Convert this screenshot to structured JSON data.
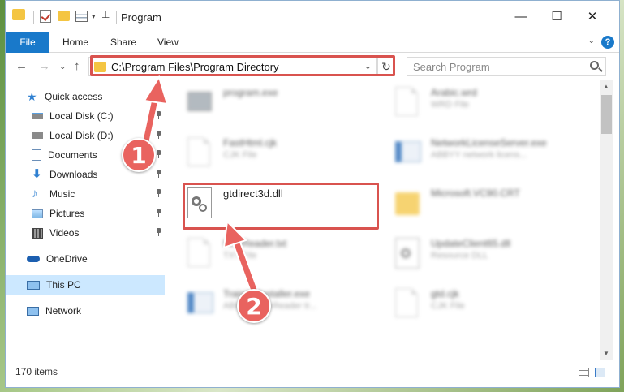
{
  "window": {
    "title": "Program",
    "minimize_glyph": "—",
    "maximize_glyph": "☐",
    "close_glyph": "✕"
  },
  "ribbon": {
    "file": "File",
    "tabs": [
      "Home",
      "Share",
      "View"
    ],
    "help": "?"
  },
  "address": {
    "path": "C:\\Program Files\\Program Directory",
    "search_placeholder": "Search Program"
  },
  "nav_pane": {
    "items": [
      {
        "label": "Quick access",
        "icon": "star-icon"
      },
      {
        "label": "Local Disk (C:)",
        "icon": "drive-icon",
        "pinned": true
      },
      {
        "label": "Local Disk (D:)",
        "icon": "drive-icon",
        "pinned": true
      },
      {
        "label": "Documents",
        "icon": "documents-icon",
        "pinned": true
      },
      {
        "label": "Downloads",
        "icon": "download-icon",
        "pinned": true
      },
      {
        "label": "Music",
        "icon": "music-icon",
        "pinned": true
      },
      {
        "label": "Pictures",
        "icon": "pictures-icon",
        "pinned": true
      },
      {
        "label": "Videos",
        "icon": "videos-icon",
        "pinned": true
      },
      {
        "label": "OneDrive",
        "icon": "cloud-icon"
      },
      {
        "label": "This PC",
        "icon": "computer-icon",
        "selected": true
      },
      {
        "label": "Network",
        "icon": "network-icon"
      }
    ]
  },
  "files": [
    {
      "name": "program.exe",
      "type": ""
    },
    {
      "name": "Arabic.wrd",
      "type": "WRD File"
    },
    {
      "name": "FastHtml.cjk",
      "type": "CJK File"
    },
    {
      "name": "NetworkLicenseServer.exe",
      "type": "ABBYY network licens..."
    },
    {
      "name": "gtdirect3d.dll",
      "type": ""
    },
    {
      "name": "Microsoft.VC90.CRT",
      "type": ""
    },
    {
      "name": "FineReader.txt",
      "type": "TXT File"
    },
    {
      "name": "UpdateClient65.dll",
      "type": "Resource DLL"
    },
    {
      "name": "TrainingInstaller.exe",
      "type": "ABBYY FineReader tr..."
    },
    {
      "name": "gtd.cjk",
      "type": "CJK File"
    }
  ],
  "status": {
    "item_count": "170 items"
  },
  "annotations": {
    "step1": "1",
    "step2": "2",
    "color": "#e9635f"
  }
}
